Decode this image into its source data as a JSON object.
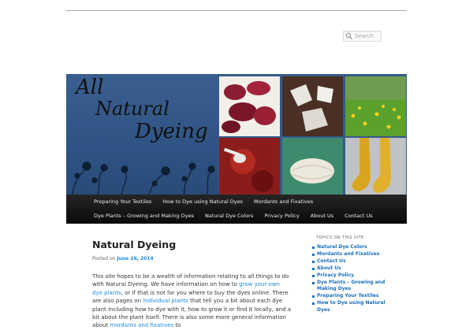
{
  "search": {
    "placeholder": "Search"
  },
  "banner": {
    "title_lines": [
      "All",
      "Natural",
      "Dyeing"
    ]
  },
  "nav": {
    "row1": [
      "Preparing Your Textiles",
      "How to Dye using Natural Dyes",
      "Mordants and Fixatives"
    ],
    "row2": [
      "Dye Plants – Growing and Making Dyes",
      "Natural Dye Colors",
      "Privacy Policy",
      "About Us",
      "Contact Us"
    ]
  },
  "post": {
    "title": "Natural Dyeing",
    "posted_on": "Posted on",
    "date": "June 26, 2014",
    "p1_a": "This site hopes to be a wealth of information relating to all things to do with Natural Dyeing. We have information on how to ",
    "link_grow": "grow your own dye plants",
    "p1_b": ", or if that is not for you where to buy the dyes online. There are also pages on ",
    "link_individual": "individual plants",
    "p1_c": " that tell you a bit about each dye plant including how to dye with it, how to grow it or find it locally, and a bit about the plant itself. There is also some more general information about ",
    "link_mordants": "mordants and fixatives",
    "p1_d": " to"
  },
  "sidebar": {
    "title": "TOPICS ON THIS SITE",
    "items": [
      "Natural Dye Colors",
      "Mordants and Fixatives",
      "Contact Us",
      "About Us",
      "Privacy Policy",
      "Dye Plants – Growing and Making Dyes",
      "Preparing Your Textiles",
      "How to Dye using Natural Dyes"
    ]
  }
}
